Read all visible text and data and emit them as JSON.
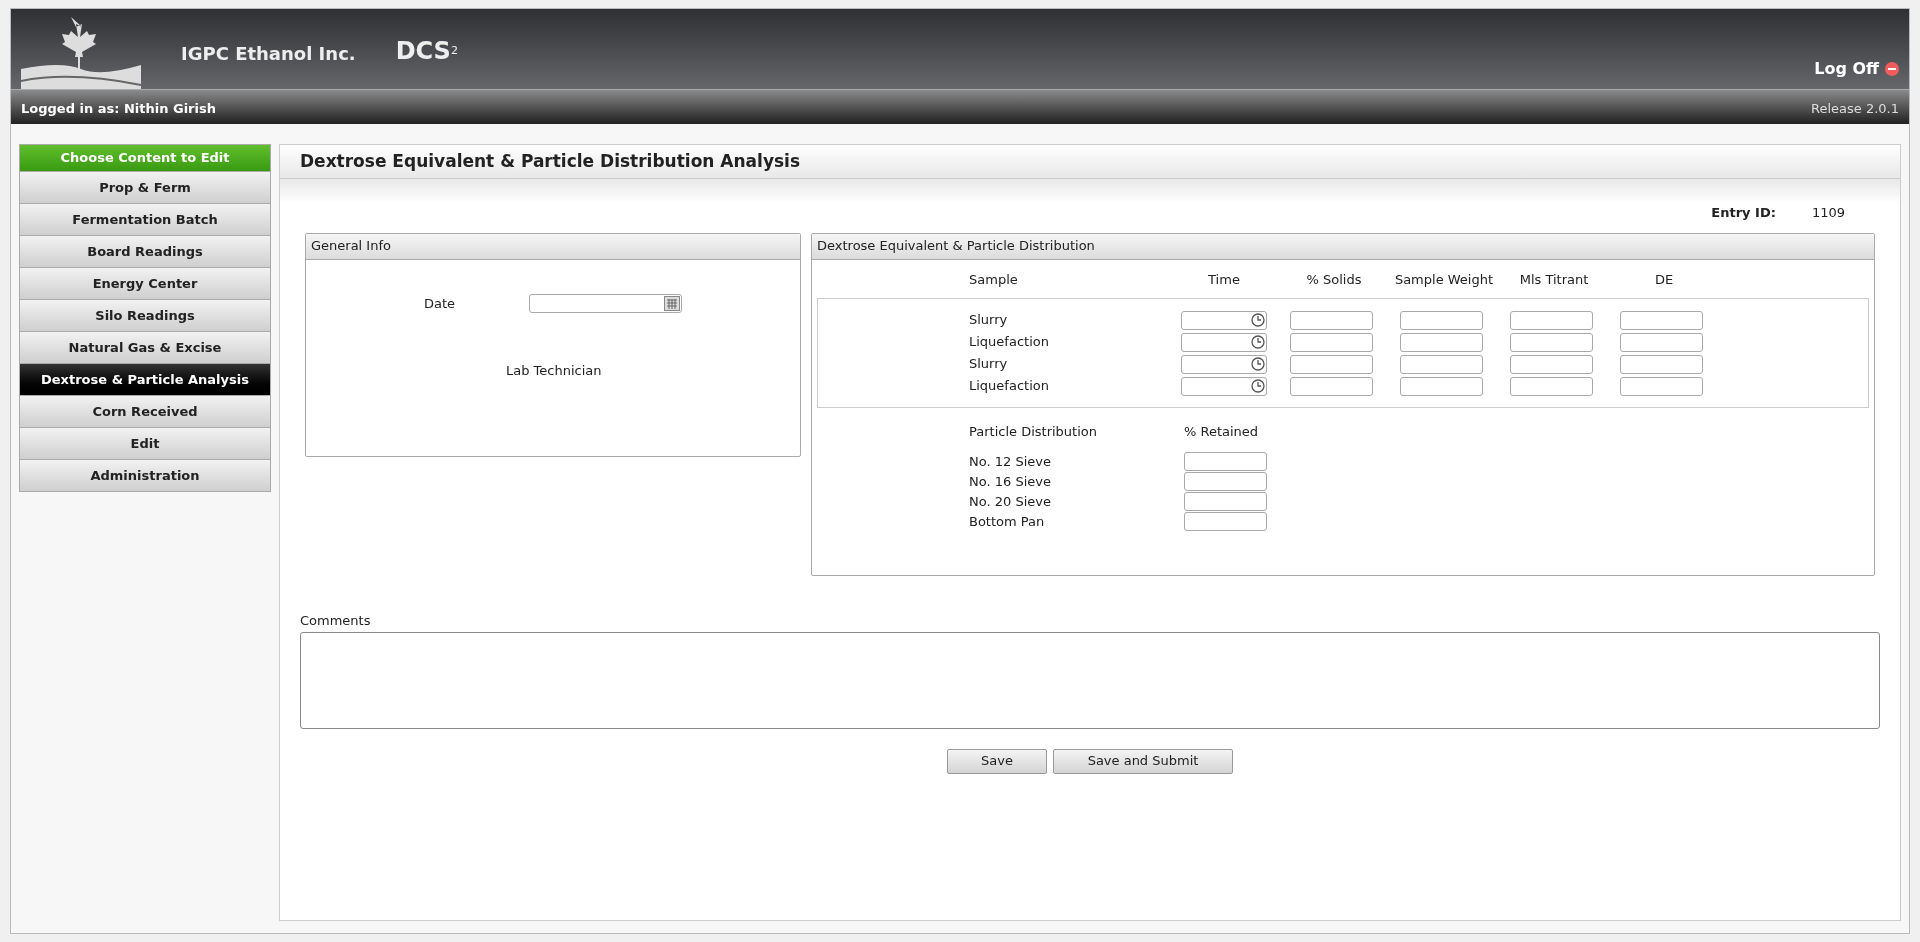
{
  "header": {
    "company": "IGPC Ethanol Inc.",
    "product": "DCS",
    "product_sup": "2",
    "logoff": "Log Off",
    "logged_in": "Logged in as: Nithin Girish",
    "release": "Release 2.0.1"
  },
  "sidebar": {
    "title": "Choose Content to Edit",
    "items": [
      {
        "label": "Prop & Ferm",
        "selected": false
      },
      {
        "label": "Fermentation Batch",
        "selected": false
      },
      {
        "label": "Board Readings",
        "selected": false
      },
      {
        "label": "Energy Center",
        "selected": false
      },
      {
        "label": "Silo Readings",
        "selected": false
      },
      {
        "label": "Natural Gas & Excise",
        "selected": false
      },
      {
        "label": "Dextrose & Particle Analysis",
        "selected": true
      },
      {
        "label": "Corn Received",
        "selected": false
      },
      {
        "label": "Edit",
        "selected": false
      },
      {
        "label": "Administration",
        "selected": false
      }
    ]
  },
  "page": {
    "title": "Dextrose Equivalent & Particle Distribution Analysis",
    "entry_id_label": "Entry ID:",
    "entry_id": "1109"
  },
  "general_info": {
    "title": "General Info",
    "date_label": "Date",
    "technician_label": "Lab Technician"
  },
  "de": {
    "title": "Dextrose Equivalent & Particle Distribution",
    "columns": [
      "Sample",
      "Time",
      "% Solids",
      "Sample Weight",
      "Mls Titrant",
      "DE"
    ],
    "rows": [
      "Slurry",
      "Liquefaction",
      "Slurry",
      "Liquefaction"
    ],
    "particle_columns": [
      "Particle Distribution",
      "% Retained"
    ],
    "particle_rows": [
      "No. 12 Sieve",
      "No. 16 Sieve",
      "No. 20 Sieve",
      "Bottom Pan"
    ]
  },
  "comments_label": "Comments",
  "buttons": [
    "Save",
    "Save and Submit"
  ]
}
